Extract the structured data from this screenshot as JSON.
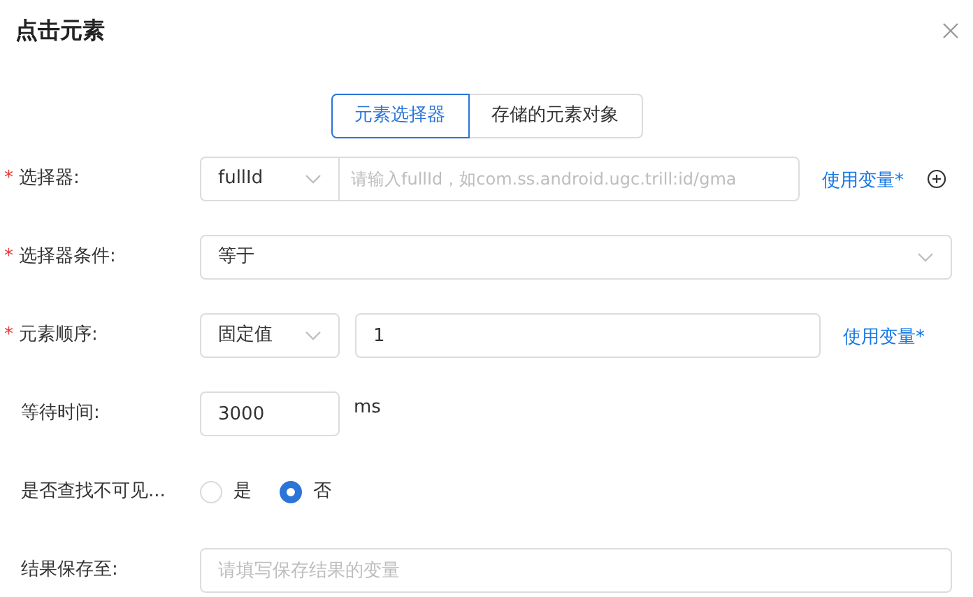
{
  "title": "点击元素",
  "tabs": [
    {
      "label": "元素选择器",
      "selected": true
    },
    {
      "label": "存储的元素对象",
      "selected": false
    }
  ],
  "rows": [
    {
      "kind": "selector",
      "label": "选择器:",
      "required_mark": "*",
      "select": "fullId",
      "placeholder": "请输入fullId，如com.ss.android.ugc.trill:id/gma",
      "link": "使用变量*"
    },
    {
      "kind": "select",
      "label": "选择器条件:",
      "required_mark": "*",
      "select": "等于"
    },
    {
      "kind": "order",
      "label": "元素顺序:",
      "required_mark": "*",
      "select": "固定值",
      "value": "1",
      "link": "使用变量*"
    },
    {
      "kind": "number",
      "label": "等待时间:",
      "value": "3000",
      "unit": "ms"
    },
    {
      "kind": "radio",
      "label": "是否查找不可见...",
      "options": [
        {
          "label": "是",
          "selected": false
        },
        {
          "label": "否",
          "selected": true
        }
      ]
    },
    {
      "kind": "text",
      "label": "结果保存至:",
      "placeholder": "请填写保存结果的变量"
    }
  ]
}
